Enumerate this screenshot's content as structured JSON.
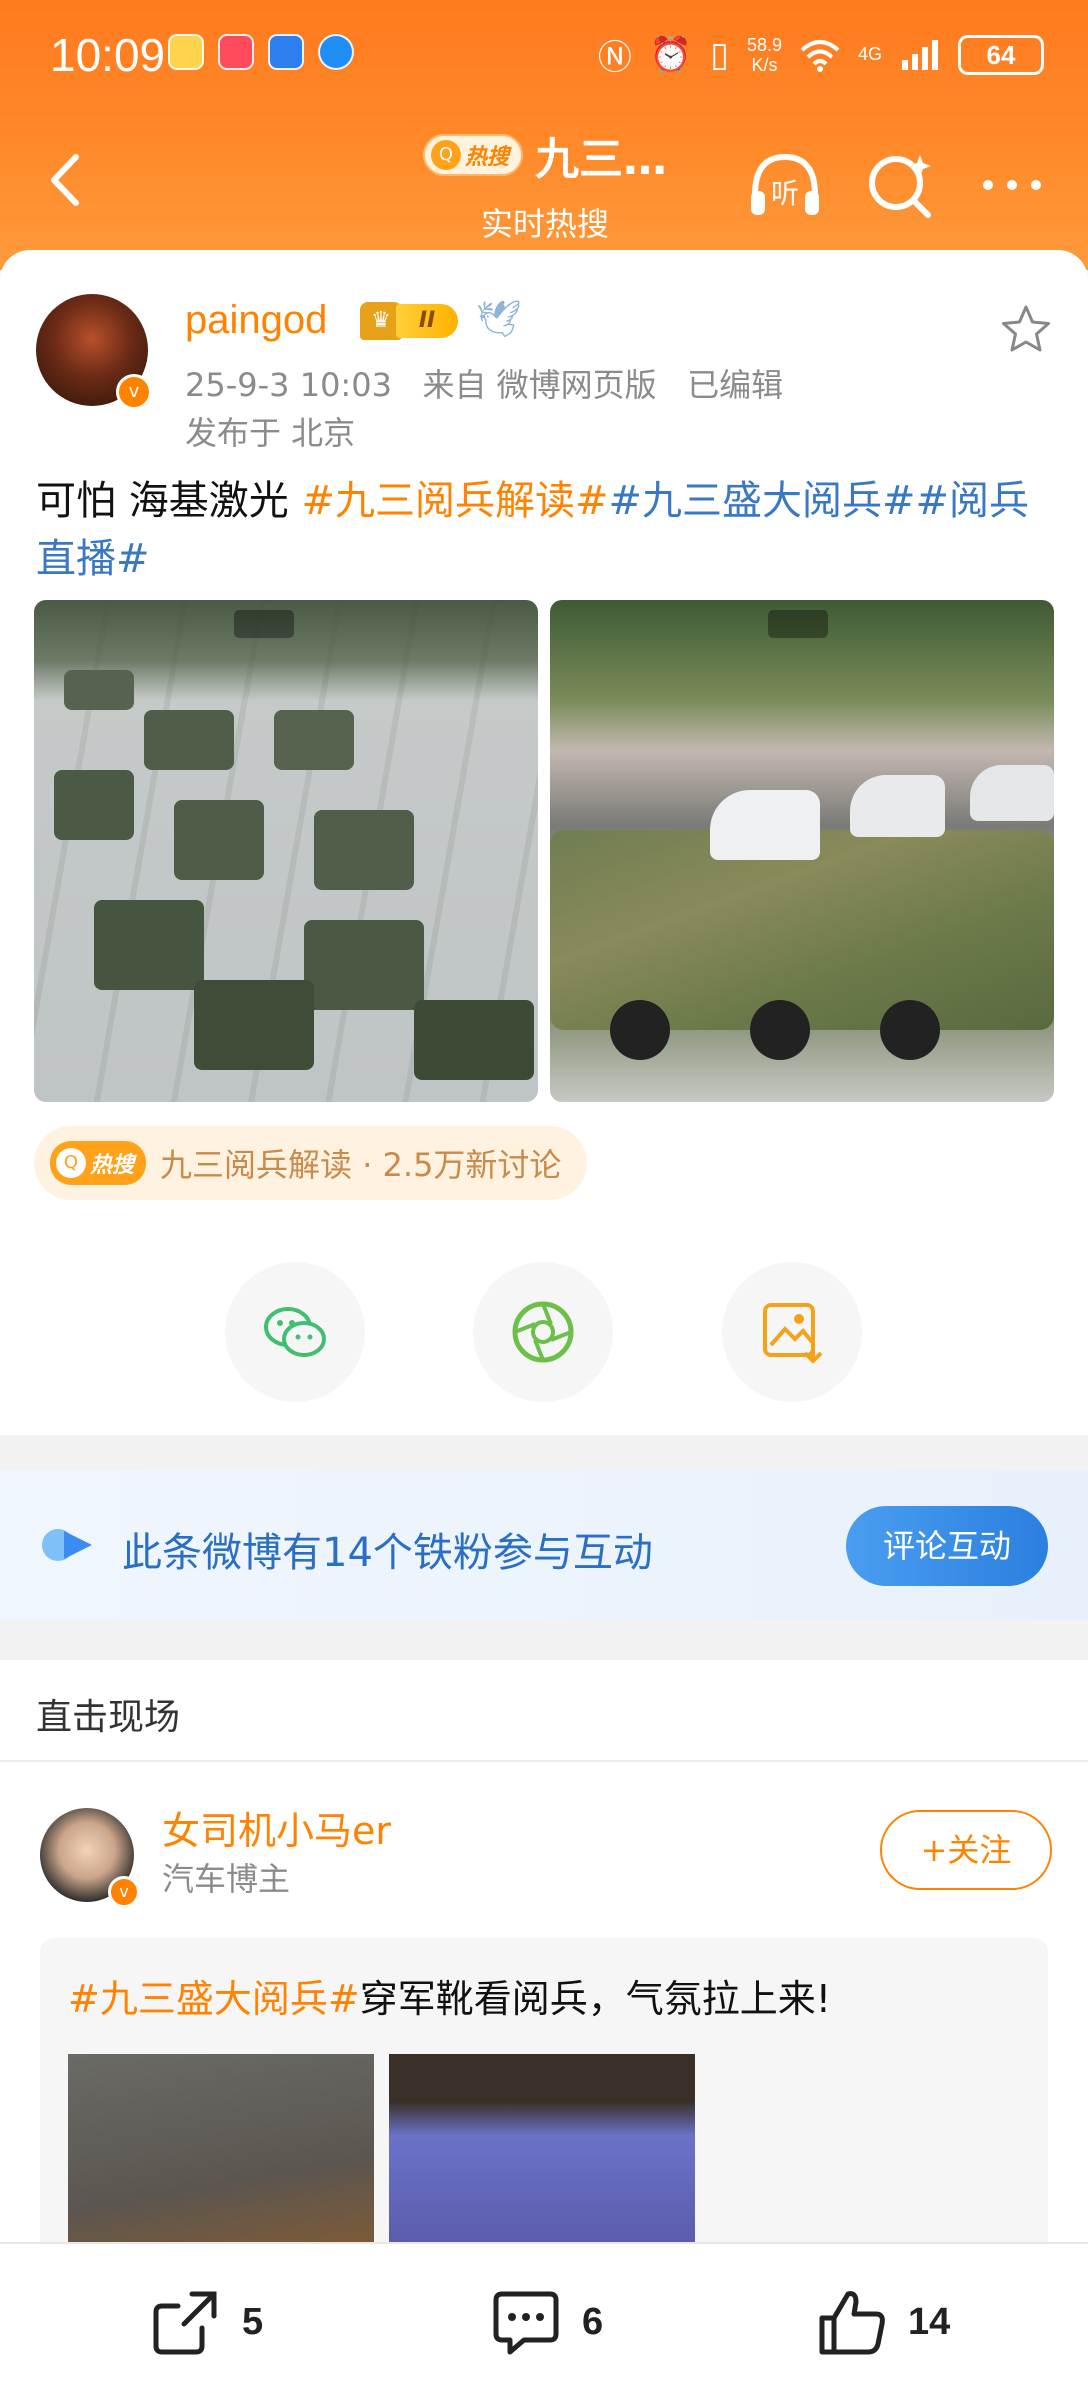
{
  "status_bar": {
    "time": "10:09",
    "net_speed_value": "58.9",
    "net_speed_unit": "K/s",
    "network": "4G",
    "battery": "64"
  },
  "nav": {
    "hot_badge": "热搜",
    "title": "九三…",
    "subtitle": "实时热搜",
    "listen_label": "听"
  },
  "post": {
    "username": "paingod",
    "level": "II",
    "timestamp": "25-9-3 10:03",
    "source": "来自 微博网页版",
    "edited": "已编辑",
    "location": "发布于 北京",
    "text_plain": "可怕 海基激光 ",
    "tag1": "#九三阅兵解读#",
    "tag2": "#九三盛大阅兵##阅兵直播#",
    "topic_chip": {
      "badge": "热搜",
      "text": "九三阅兵解读 · 2.5万新讨论"
    }
  },
  "fans_banner": {
    "text": "此条微博有14个铁粉参与互动",
    "button": "评论互动"
  },
  "live_section": {
    "title": "直击现场",
    "author": "女司机小马er",
    "role": "汽车博主",
    "follow": "+关注",
    "tag": "#九三盛大阅兵#",
    "text": "穿军靴看阅兵，气氛拉上来!"
  },
  "bottom_bar": {
    "reposts": "5",
    "comments": "6",
    "likes": "14"
  },
  "colors": {
    "accent": "#ff8200",
    "link_blue": "#3a78c4",
    "header": "#ff8a2a"
  }
}
